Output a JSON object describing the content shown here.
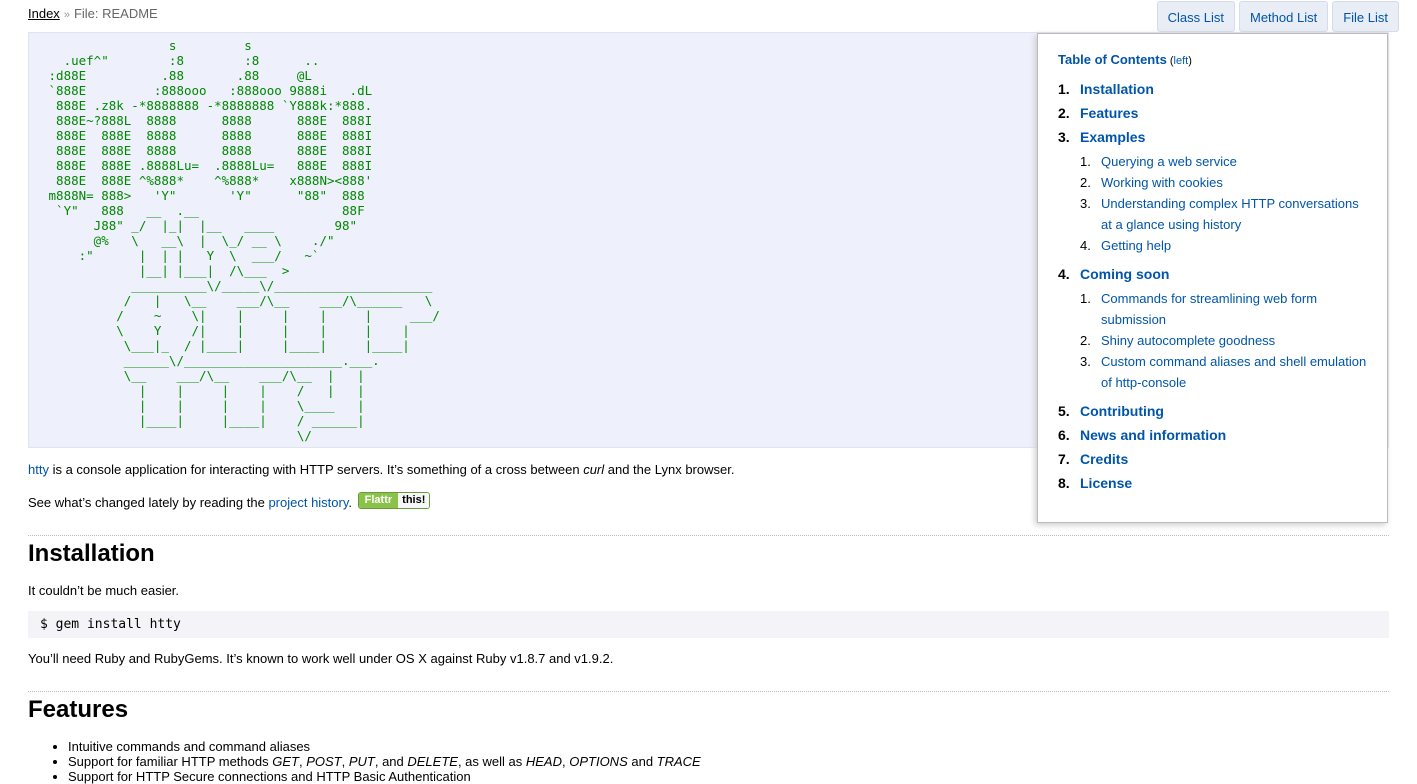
{
  "breadcrumb": {
    "index_label": "Index",
    "separator": "»",
    "current": "File: README"
  },
  "menu": {
    "class_list": "Class List",
    "method_list": "Method List",
    "file_list": "File List"
  },
  "ascii_art": "                 s         s\n   .uef^\"        :8        :8      ..\n :d88E          .88       .88     @L\n `888E         :888ooo   :888ooo 9888i   .dL\n  888E .z8k -*8888888 -*8888888 `Y888k:*888.\n  888E~?888L  8888      8888      888E  888I\n  888E  888E  8888      8888      888E  888I\n  888E  888E  8888      8888      888E  888I\n  888E  888E .8888Lu=  .8888Lu=   888E  888I\n  888E  888E ^%888*    ^%888*    x888N><888'\n m888N= 888>   'Y\"       'Y\"      \"88\"  888\n  `Y\"   888   __  .__                   88F\n       J88\" _/  |_|  |__   ____        98\"\n       @%   \\   __\\  |  \\_/ __ \\    ./\"\n     :\"      |  | |   Y  \\  ___/   ~`\n             |__| |___|  /\\___  >\n            __________\\/_____\\/_____________________\n           /   |   \\__    ___/\\__    ___/\\______   \\\n          /    ~    \\|    |     |    |     |     ___/\n          \\    Y    /|    |     |    |     |    |\n           \\___|_  / |____|     |____|     |____|\n           ______\\/_____________________.___.\n           \\__    ___/\\__    ___/\\__  |   |\n             |    |     |    |    /   |   |\n             |    |     |    |    \\____   |\n             |____|     |____|    / ______|\n                                  \\/",
  "intro": {
    "link": "htty",
    "text_a": " is a console application for interacting with HTTP servers. It’s something of a cross between ",
    "em": "curl",
    "text_b": " and the Lynx browser."
  },
  "history": {
    "text_a": "See what’s changed lately by reading the ",
    "link": "project history",
    "text_b": ".",
    "flattr_a": "Flattr",
    "flattr_b": "this!"
  },
  "installation": {
    "heading": "Installation",
    "p1": "It couldn’t be much easier.",
    "code": "$ gem install htty",
    "p2": "You’ll need Ruby and RubyGems. It’s known to work well under OS X against Ruby v1.8.7 and v1.9.2."
  },
  "features": {
    "heading": "Features",
    "items": [
      {
        "text": "Intuitive commands and command aliases"
      },
      {
        "a": "Support for familiar HTTP methods ",
        "m1": "GET",
        "c1": ", ",
        "m2": "POST",
        "c2": ", ",
        "m3": "PUT",
        "c3": ", and ",
        "m4": "DELETE",
        "c4": ", as well as ",
        "m5": "HEAD",
        "c5": ", ",
        "m6": "OPTIONS",
        "c6": " and ",
        "m7": "TRACE"
      },
      {
        "text": "Support for HTTP Secure connections and HTTP Basic Authentication"
      }
    ]
  },
  "toc": {
    "title": "Table of Contents",
    "hide_open": " (",
    "hide_link": "left",
    "hide_close": ")",
    "items": [
      {
        "num": "1.",
        "label": "Installation"
      },
      {
        "num": "2.",
        "label": "Features"
      },
      {
        "num": "3.",
        "label": "Examples",
        "sub": [
          {
            "num": "1.",
            "label": "Querying a web service"
          },
          {
            "num": "2.",
            "label": "Working with cookies"
          },
          {
            "num": "3.",
            "label": "Understanding complex HTTP conversations at a glance using history"
          },
          {
            "num": "4.",
            "label": "Getting help"
          }
        ]
      },
      {
        "num": "4.",
        "label": "Coming soon",
        "sub": [
          {
            "num": "1.",
            "label": "Commands for streamlining web form submission"
          },
          {
            "num": "2.",
            "label": "Shiny autocomplete goodness"
          },
          {
            "num": "3.",
            "label": "Custom command aliases and shell emulation of http-console"
          }
        ]
      },
      {
        "num": "5.",
        "label": "Contributing"
      },
      {
        "num": "6.",
        "label": "News and information"
      },
      {
        "num": "7.",
        "label": "Credits"
      },
      {
        "num": "8.",
        "label": "License"
      }
    ]
  }
}
